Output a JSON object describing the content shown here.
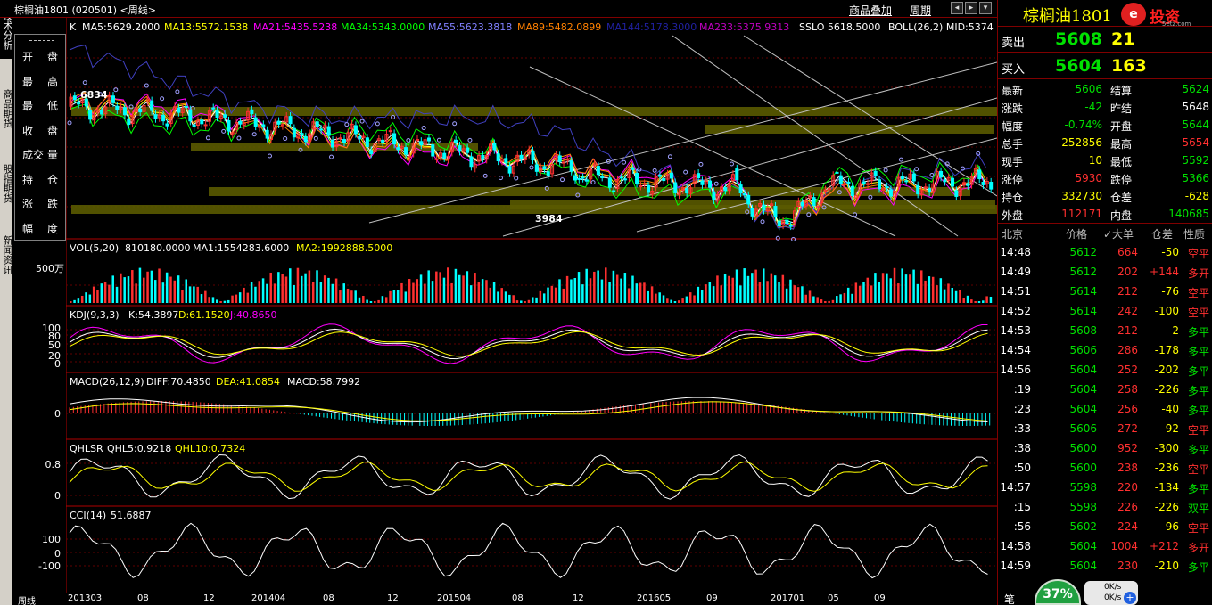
{
  "titlebar": {
    "title": "棕榈油1801 (020501) <周线>",
    "link_overlay": "商品叠加",
    "link_period": "周期",
    "btn_left": "◂",
    "btn_right": "▸",
    "btn_down": "▾",
    "btn_close": "✕"
  },
  "left_tabs": [
    {
      "label": "技术分析",
      "active": true
    },
    {
      "label": "商品期货",
      "active": false
    },
    {
      "label": "股指期货",
      "active": false
    },
    {
      "label": "新闻资讯",
      "active": false
    }
  ],
  "data_window": [
    {
      "l": "开",
      "r": "盘"
    },
    {
      "l": "最",
      "r": "高"
    },
    {
      "l": "最",
      "r": "低"
    },
    {
      "l": "收",
      "r": "盘"
    },
    {
      "l": "成交",
      "r": "量"
    },
    {
      "l": "持",
      "r": "仓"
    },
    {
      "l": "涨",
      "r": "跌"
    },
    {
      "l": "幅",
      "r": "度"
    }
  ],
  "indicators": {
    "main": {
      "k": "K",
      "ma5": "MA5:5629.2000",
      "ma13": "MA13:5572.1538",
      "ma21": "MA21:5435.5238",
      "ma34": "MA34:5343.0000",
      "ma55": "MA55:5623.3818",
      "ma89": "MA89:5482.0899",
      "ma144": "MA144:5178.3000",
      "ma233": "MA233:5375.9313",
      "sslo": "SSLO  5618.5000",
      "boll": "BOLL(26,2)  MID:5374",
      "high_mark": "6834",
      "low_mark": "3984"
    },
    "vol": {
      "name": "VOL(5,20)",
      "v": "810180.0000",
      "ma1": "MA1:1554283.6000",
      "ma2": "MA2:1992888.5000",
      "axis": "500万"
    },
    "kdj": {
      "name": "KDJ(9,3,3)",
      "k": "K:54.3897",
      "d": "D:61.1520",
      "j": "J:40.8650",
      "axis": [
        "100",
        "80",
        "50",
        "20",
        "0"
      ]
    },
    "macd": {
      "name": "MACD(26,12,9)",
      "diff": "DIFF:70.4850",
      "dea": "DEA:41.0854",
      "macd": "MACD:58.7992",
      "axis": [
        "0"
      ]
    },
    "qhlsr": {
      "name": "QHLSR",
      "q5": "QHL5:0.9218",
      "q10": "QHL10:0.7324",
      "axis": [
        "0.8",
        "0"
      ]
    },
    "cci": {
      "name": "CCI(14)",
      "v": "51.6887",
      "axis": [
        "100",
        "0",
        "-100"
      ]
    }
  },
  "xaxis": {
    "period": "周线",
    "labels": [
      "201303",
      "08",
      "12",
      "201404",
      "08",
      "12",
      "201504",
      "08",
      "12",
      "201605",
      "09",
      "201701",
      "05",
      "09"
    ]
  },
  "quote": {
    "name": "棕榈油1801",
    "brand": "投资",
    "site": "5etz.com",
    "logo": "e",
    "sell_label": "卖出",
    "sell_price": "5608",
    "sell_vol": "21",
    "buy_label": "买入",
    "buy_price": "5604",
    "buy_vol": "163",
    "rows": [
      {
        "k1": "最新",
        "v1": "5606",
        "c1": "green",
        "k2": "结算",
        "v2": "5624",
        "c2": "green"
      },
      {
        "k1": "涨跌",
        "v1": "-42",
        "c1": "green",
        "k2": "昨结",
        "v2": "5648",
        "c2": "white"
      },
      {
        "k1": "幅度",
        "v1": "-0.74%",
        "c1": "green",
        "k2": "开盘",
        "v2": "5644",
        "c2": "green"
      },
      {
        "k1": "总手",
        "v1": "252856",
        "c1": "yellow",
        "k2": "最高",
        "v2": "5654",
        "c2": "red"
      },
      {
        "k1": "现手",
        "v1": "10",
        "c1": "yellow",
        "k2": "最低",
        "v2": "5592",
        "c2": "green"
      },
      {
        "k1": "涨停",
        "v1": "5930",
        "c1": "red",
        "k2": "跌停",
        "v2": "5366",
        "c2": "green"
      },
      {
        "k1": "持仓",
        "v1": "332730",
        "c1": "yellow",
        "k2": "仓差",
        "v2": "-628",
        "c2": "yellow"
      },
      {
        "k1": "外盘",
        "v1": "112171",
        "c1": "red",
        "k2": "内盘",
        "v2": "140685",
        "c2": "green"
      }
    ]
  },
  "trades_header": {
    "time": "北京",
    "price": "价格",
    "vol": "✓大单",
    "oi": "仓差",
    "nature": "性质"
  },
  "trades": [
    {
      "t": "14:48",
      "p": "5612",
      "v": "664",
      "oi": "-50",
      "n": "空平",
      "nc": "red"
    },
    {
      "t": "14:49",
      "p": "5612",
      "v": "202",
      "oi": "+144",
      "n": "多开",
      "nc": "red"
    },
    {
      "t": "14:51",
      "p": "5614",
      "v": "212",
      "oi": "-76",
      "n": "空平",
      "nc": "red"
    },
    {
      "t": "14:52",
      "p": "5614",
      "v": "242",
      "oi": "-100",
      "n": "空平",
      "nc": "red"
    },
    {
      "t": "14:53",
      "p": "5608",
      "v": "212",
      "oi": "-2",
      "n": "多平",
      "nc": "green"
    },
    {
      "t": "14:54",
      "p": "5606",
      "v": "286",
      "oi": "-178",
      "n": "多平",
      "nc": "green"
    },
    {
      "t": "14:56",
      "p": "5604",
      "v": "252",
      "oi": "-202",
      "n": "多平",
      "nc": "green"
    },
    {
      "t": ":19",
      "p": "5604",
      "v": "258",
      "oi": "-226",
      "n": "多平",
      "nc": "green"
    },
    {
      "t": ":23",
      "p": "5604",
      "v": "256",
      "oi": "-40",
      "n": "多平",
      "nc": "green"
    },
    {
      "t": ":33",
      "p": "5606",
      "v": "272",
      "oi": "-92",
      "n": "空平",
      "nc": "red"
    },
    {
      "t": ":38",
      "p": "5600",
      "v": "952",
      "oi": "-300",
      "n": "多平",
      "nc": "green"
    },
    {
      "t": ":50",
      "p": "5600",
      "v": "238",
      "oi": "-236",
      "n": "空平",
      "nc": "red"
    },
    {
      "t": "14:57",
      "p": "5598",
      "v": "220",
      "oi": "-134",
      "n": "多平",
      "nc": "green"
    },
    {
      "t": ":15",
      "p": "5598",
      "v": "226",
      "oi": "-226",
      "n": "双平",
      "nc": "green"
    },
    {
      "t": ":56",
      "p": "5602",
      "v": "224",
      "oi": "-96",
      "n": "空平",
      "nc": "red"
    },
    {
      "t": "14:58",
      "p": "5604",
      "v": "1004",
      "oi": "+212",
      "n": "多开",
      "nc": "red"
    },
    {
      "t": "14:59",
      "p": "5604",
      "v": "230",
      "oi": "-210",
      "n": "多平",
      "nc": "green"
    }
  ],
  "widget": {
    "pct": "37%",
    "up": "0K/s",
    "down": "0K/s",
    "plus": "+",
    "bk": "笔"
  },
  "colors": {
    "up": "#ff3030",
    "down": "#00ffff",
    "grid": "#800000",
    "ma5": "#ffffff",
    "ma13": "#ffff00",
    "ma21": "#ff00ff",
    "ma34": "#00ff00",
    "ma55": "#8080ff",
    "ma89": "#ff8000"
  }
}
